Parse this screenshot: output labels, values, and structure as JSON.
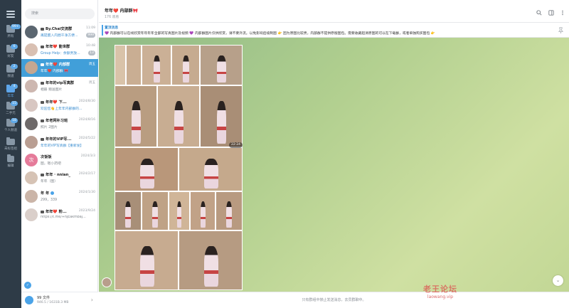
{
  "sidebar": {
    "folders": [
      {
        "label": "所有",
        "badge": "99+"
      },
      {
        "label": "好友",
        "badge": "6"
      },
      {
        "label": "频道",
        "badge": "2"
      },
      {
        "label": "年年",
        "badge": "4"
      },
      {
        "label": "二手元",
        "badge": "15"
      },
      {
        "label": "个人频道",
        "badge": "18"
      },
      {
        "label": "未标签组",
        "badge": ""
      },
      {
        "label": "编辑",
        "badge": ""
      }
    ]
  },
  "chatlist": {
    "search_placeholder": "搜索",
    "chats": [
      {
        "name": "By.Chai交流群",
        "time": "11:09",
        "preview": "再提醒入内圈干净方便...",
        "unread": "999",
        "blue": false
      },
      {
        "name": "年年❤️ 能世群",
        "time": "10:48",
        "preview": "Group Help：余额贵放...",
        "unread": "13",
        "blue": true
      },
      {
        "name": "年年❤️ 内部群",
        "time": "周五",
        "preview": "年年❤️ 内部群 🎀",
        "unread": "",
        "blue": false
      },
      {
        "name": "年年的vip写真群",
        "time": "周五",
        "preview": "相册 赠送图片",
        "unread": "",
        "blue": false
      },
      {
        "name": "年年❤️ 下...",
        "time": "2024/8/30",
        "preview": "欢迎您👋上年年内部群的...",
        "unread": "",
        "blue": true
      },
      {
        "name": "年老网补习班",
        "time": "2024/8/16",
        "preview": "照片 2图片",
        "unread": "",
        "blue": false
      },
      {
        "name": "年年的VIP写...",
        "time": "2024/5/22",
        "preview": "年年的VIP写真群【重新发】",
        "unread": "",
        "blue": true
      },
      {
        "name": "次饭饭",
        "time": "2024/3/3",
        "preview": "图，嗯小药吧",
        "unread": "",
        "blue": false
      },
      {
        "name": "年年 · nnian_",
        "time": "2024/2/17",
        "preview": "年年（图）",
        "unread": "",
        "blue": false
      },
      {
        "name": "年 年",
        "time": "2024/1/30",
        "preview": "299，339",
        "unread": "",
        "blue": false
      },
      {
        "name": "年年❤️ 粉...",
        "time": "2023/9/24",
        "preview": "https://t.me/+hjEakmbajdoxx...",
        "unread": "",
        "blue": false
      }
    ],
    "footer": {
      "title": "99 文件",
      "size": "946.5 / 1631B.3 MB"
    }
  },
  "header": {
    "title": "年年❤️ 内部群🎀",
    "subtitle": "176 观看"
  },
  "pinned": {
    "title": "置顶消息",
    "text": "💜 内部群可以在线欣赏年年年年全部的写真图片及视频 💜 内部群图片仅供欣赏，请不要外流。以免影响后续制图 👉 因为原图比较贵，内部群不提供原版图包。需要收藏超清原图的可以在下载群，或者单独购买图包 👉"
  },
  "gallery": {
    "duration": "22:24"
  },
  "footer": {
    "text": "只有群组中禁止发送消息，去员群聊中。"
  },
  "watermark": {
    "line1": "老王论坛",
    "line2": "laowang.vip"
  },
  "colors": {
    "accent": "#419fd9",
    "rail": "#2e3b47"
  }
}
